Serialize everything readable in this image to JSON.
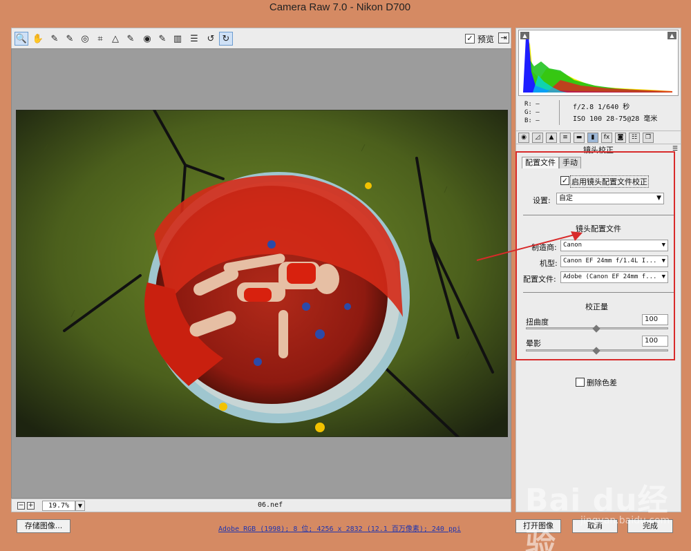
{
  "window": {
    "title": "Camera Raw 7.0 -  Nikon D700"
  },
  "toolbar": {
    "tools": [
      {
        "icon": "zoom-icon",
        "glyph": "🔍",
        "active": true
      },
      {
        "icon": "hand-icon",
        "glyph": "✋"
      },
      {
        "icon": "white-balance-icon",
        "glyph": "✎"
      },
      {
        "icon": "color-sampler-icon",
        "glyph": "✎"
      },
      {
        "icon": "targeted-adjustment-icon",
        "glyph": "◎"
      },
      {
        "icon": "crop-icon",
        "glyph": "⌗"
      },
      {
        "icon": "straighten-icon",
        "glyph": "△"
      },
      {
        "icon": "spot-removal-icon",
        "glyph": "✎"
      },
      {
        "icon": "red-eye-icon",
        "glyph": "◉"
      },
      {
        "icon": "adjustment-brush-icon",
        "glyph": "✎"
      },
      {
        "icon": "graduated-filter-icon",
        "glyph": "▥"
      },
      {
        "icon": "preferences-icon",
        "glyph": "☰"
      },
      {
        "icon": "rotate-left-icon",
        "glyph": "↺"
      },
      {
        "icon": "rotate-right-icon",
        "glyph": "↻",
        "active": true
      }
    ],
    "preview_label": "预览",
    "preview_checked": true
  },
  "status": {
    "zoom_minus": "−",
    "zoom_plus": "+",
    "zoom_value": "19.7%",
    "filename": "06.nef"
  },
  "histogram": {
    "rgb_lines": [
      "R:  —",
      "G:  —",
      "B:  —"
    ],
    "exif_line1": "f/2.8  1/640 秒",
    "exif_line2": "ISO 100  28-75@28 毫米"
  },
  "panel": {
    "section_title": "镜头校正",
    "subtabs": [
      "配置文件",
      "手动"
    ],
    "enable_profile_label": "启用镜头配置文件校正",
    "enable_profile_checked": true,
    "setup_label": "设置:",
    "setup_value": "自定",
    "lens_profile_heading": "镜头配置文件",
    "make_label": "制造商:",
    "make_value": "Canon",
    "model_label": "机型:",
    "model_value": "Canon EF 24mm f/1.4L I...",
    "profile_label": "配置文件:",
    "profile_value": "Adobe (Canon EF 24mm f...",
    "correction_heading": "校正量",
    "distortion_label": "扭曲度",
    "distortion_value": "100",
    "vignetting_label": "晕影",
    "vignetting_value": "100",
    "remove_ca_label": "删除色差",
    "remove_ca_checked": false
  },
  "footer": {
    "save_label": "存储图像...",
    "workflow_text": "Adobe RGB (1998); 8 位; 4256 x 2832 (12.1 百万像素); 240 ppi",
    "open_label": "打开图像",
    "cancel_label": "取消",
    "done_label": "完成"
  },
  "watermark": {
    "text": "Bai du经验",
    "sub": "jingyan.baidu.com"
  }
}
